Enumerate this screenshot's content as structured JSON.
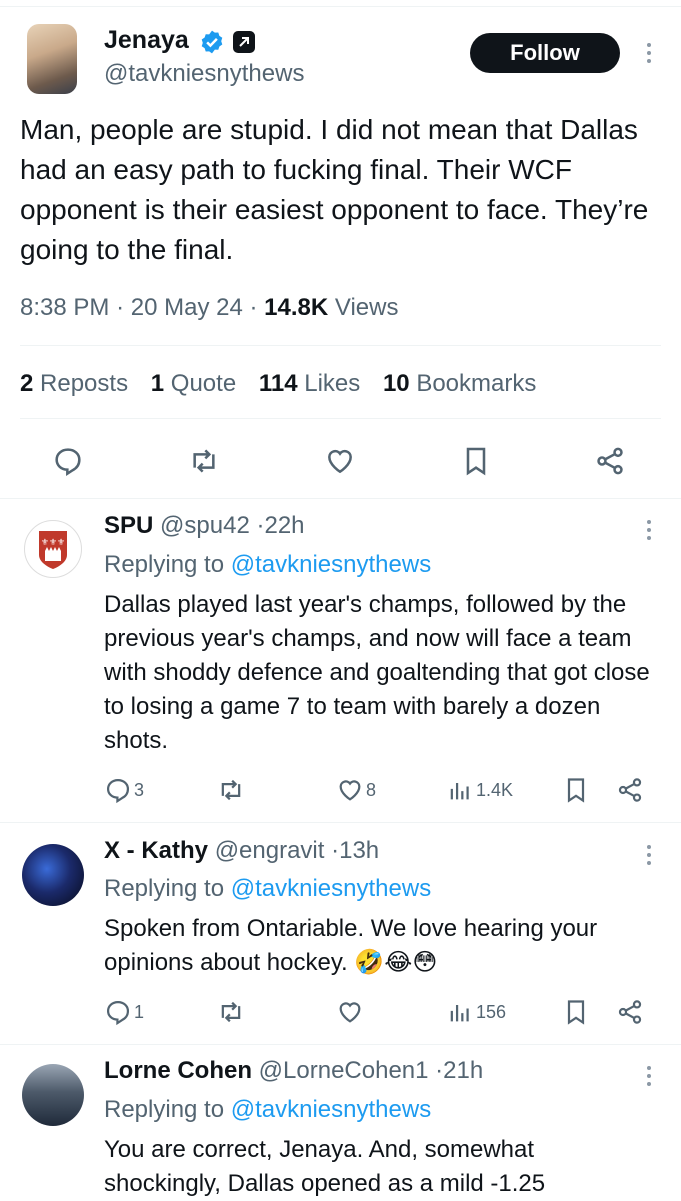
{
  "tweet": {
    "author_name": "Jenaya",
    "handle": "@tavkniesnythews",
    "follow_label": "Follow",
    "text": "Man, people are stupid. I did not mean that Dallas had an easy path to fucking final. Their WCF opponent is their easiest opponent to face. They’re going to the final.",
    "time": "8:38 PM",
    "date": "20 May 24",
    "views_count": "14.8K",
    "views_label": "Views",
    "stats": {
      "reposts_count": "2",
      "reposts_label": "Reposts",
      "quotes_count": "1",
      "quotes_label": "Quote",
      "likes_count": "114",
      "likes_label": "Likes",
      "bookmarks_count": "10",
      "bookmarks_label": "Bookmarks"
    }
  },
  "replies": [
    {
      "name": "SPU",
      "handle": "@spu42",
      "age": "22h",
      "replying_label": "Replying to",
      "replying_handle": "@tavkniesnythews",
      "text": "Dallas played last year's champs, followed by the previous year's champs, and now will face a team with shoddy defence and goaltending that got close to losing a game 7 to team with barely a dozen shots.",
      "replies_count": "3",
      "likes_count": "8",
      "views_count": "1.4K"
    },
    {
      "name": "X - Kathy",
      "handle": "@engravit",
      "age": "13h",
      "replying_label": "Replying to",
      "replying_handle": "@tavkniesnythews",
      "text": "Spoken from Ontariable.  We love hearing your opinions about hockey. 🤣😂😳",
      "replies_count": "1",
      "likes_count": "",
      "views_count": "156"
    },
    {
      "name": "Lorne Cohen",
      "handle": "@LorneCohen1",
      "age": "21h",
      "replying_label": "Replying to",
      "replying_handle": "@tavkniesnythews",
      "text": "You are correct, Jenaya. And, somewhat shockingly, Dallas opened as a mild -1.25"
    }
  ],
  "sep": "·",
  "colors": {
    "accent": "#1d9bf0",
    "text": "#0f1419",
    "muted": "#536471",
    "verified": "#1d9bf0"
  },
  "icons": [
    "verified-badge-icon",
    "automated-label-icon",
    "more-icon",
    "reply-icon",
    "repost-icon",
    "like-icon",
    "bookmark-icon",
    "share-icon",
    "views-icon"
  ]
}
